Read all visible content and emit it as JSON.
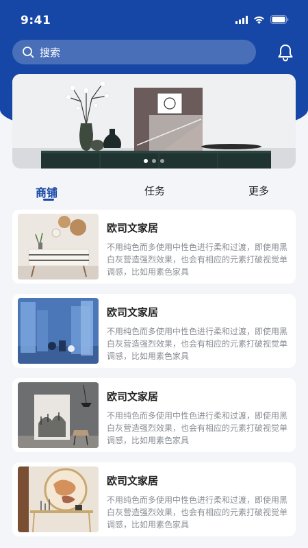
{
  "status_bar": {
    "time": "9:41"
  },
  "search": {
    "label": "搜索"
  },
  "banner": {
    "slide_count": 3,
    "active_slide": 1
  },
  "tabs": [
    {
      "label": "商铺",
      "active": true
    },
    {
      "label": "任务",
      "active": false
    },
    {
      "label": "更多",
      "active": false
    }
  ],
  "shops": [
    {
      "title": "欧司文家居",
      "description": "不用纯色而多使用中性色进行柔和过渡，即使用黑白灰营造强烈效果，也会有相应的元素打破视觉单调感，比如用素色家具"
    },
    {
      "title": "欧司文家居",
      "description": "不用纯色而多使用中性色进行柔和过渡，即使用黑白灰营造强烈效果，也会有相应的元素打破视觉单调感，比如用素色家具"
    },
    {
      "title": "欧司文家居",
      "description": "不用纯色而多使用中性色进行柔和过渡，即使用黑白灰营造强烈效果，也会有相应的元素打破视觉单调感，比如用素色家具"
    },
    {
      "title": "欧司文家居",
      "description": "不用纯色而多使用中性色进行柔和过渡，即使用黑白灰营造强烈效果，也会有相应的元素打破视觉单调感，比如用素色家具"
    }
  ],
  "colors": {
    "primary": "#1747a6",
    "background": "#f4f5f9",
    "muted_text": "#8a8d93"
  }
}
